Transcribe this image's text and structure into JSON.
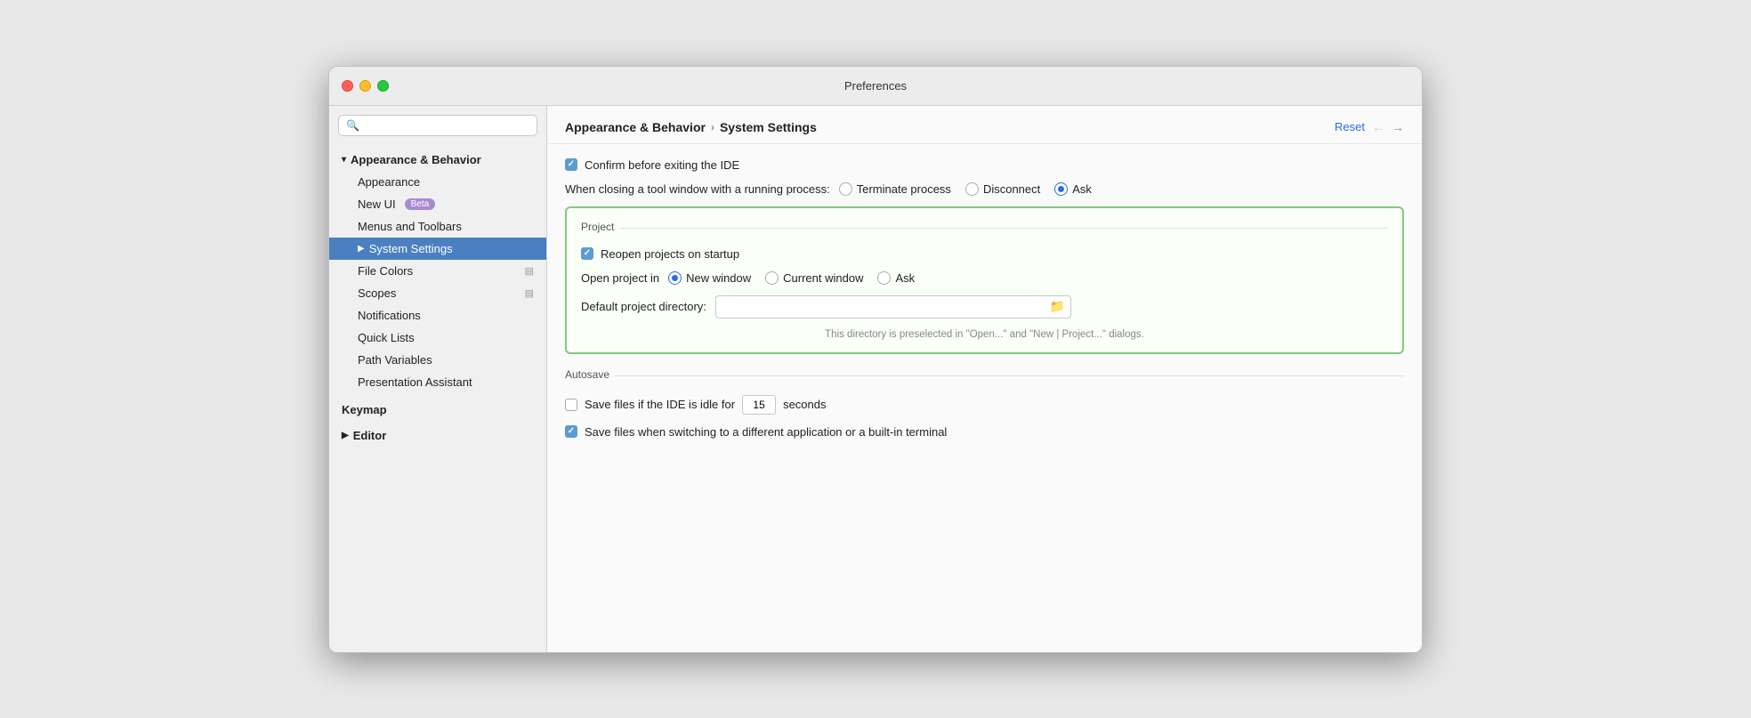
{
  "titlebar": {
    "title": "Preferences"
  },
  "sidebar": {
    "search_placeholder": "🔍",
    "items": [
      {
        "id": "appearance-behavior",
        "label": "Appearance & Behavior",
        "level": 0,
        "type": "section",
        "expanded": true
      },
      {
        "id": "appearance",
        "label": "Appearance",
        "level": 1
      },
      {
        "id": "new-ui",
        "label": "New UI",
        "level": 1,
        "badge": "Beta"
      },
      {
        "id": "menus-toolbars",
        "label": "Menus and Toolbars",
        "level": 1
      },
      {
        "id": "system-settings",
        "label": "System Settings",
        "level": 1,
        "active": true
      },
      {
        "id": "file-colors",
        "label": "File Colors",
        "level": 1,
        "has-icon": true
      },
      {
        "id": "scopes",
        "label": "Scopes",
        "level": 1,
        "has-icon": true
      },
      {
        "id": "notifications",
        "label": "Notifications",
        "level": 1
      },
      {
        "id": "quick-lists",
        "label": "Quick Lists",
        "level": 1
      },
      {
        "id": "path-variables",
        "label": "Path Variables",
        "level": 1
      },
      {
        "id": "presentation-assistant",
        "label": "Presentation Assistant",
        "level": 1
      },
      {
        "id": "keymap",
        "label": "Keymap",
        "level": 0,
        "type": "section"
      },
      {
        "id": "editor",
        "label": "Editor",
        "level": 0,
        "type": "section",
        "collapsed": true
      }
    ]
  },
  "panel": {
    "breadcrumb_part1": "Appearance & Behavior",
    "breadcrumb_part2": "System Settings",
    "reset_label": "Reset",
    "confirm_exit_label": "Confirm before exiting the IDE",
    "confirm_exit_checked": true,
    "closing_tool_window_label": "When closing a tool window with a running process:",
    "terminate_label": "Terminate process",
    "disconnect_label": "Disconnect",
    "ask_label": "Ask",
    "project_section_title": "Project",
    "reopen_projects_label": "Reopen projects on startup",
    "reopen_projects_checked": true,
    "open_project_in_label": "Open project in",
    "new_window_label": "New window",
    "current_window_label": "Current window",
    "ask_open_label": "Ask",
    "default_dir_label": "Default project directory:",
    "dir_hint": "This directory is preselected in \"Open...\" and \"New | Project...\" dialogs.",
    "autosave_section_title": "Autosave",
    "save_idle_label_before": "Save files if the IDE is idle for",
    "save_idle_value": "15",
    "save_idle_label_after": "seconds",
    "save_idle_checked": false,
    "save_switch_label": "Save files when switching to a different application or a built-in terminal",
    "save_switch_checked": true
  }
}
